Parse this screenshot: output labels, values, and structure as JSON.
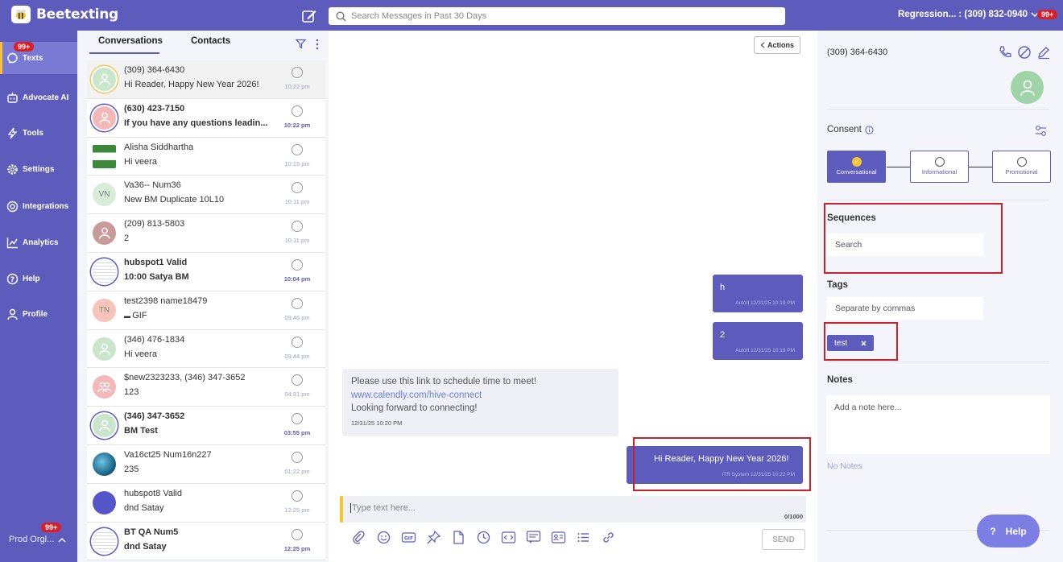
{
  "app": {
    "name": "Beetexting"
  },
  "header": {
    "search_placeholder": "Search Messages in Past 30 Days",
    "account_label": "Regression... : (309) 832-0940",
    "account_badge": "99+"
  },
  "nav": {
    "items": [
      {
        "label": "Texts",
        "icon": "chat-bubble-icon",
        "active": true,
        "badge": "99+"
      },
      {
        "label": "Advocate AI",
        "icon": "robot-icon"
      },
      {
        "label": "Tools",
        "icon": "lightning-icon"
      },
      {
        "label": "Settings",
        "icon": "gear-icon"
      },
      {
        "label": "Integrations",
        "icon": "integrations-icon"
      },
      {
        "label": "Analytics",
        "icon": "chart-icon"
      },
      {
        "label": "Help",
        "icon": "help-icon"
      },
      {
        "label": "Profile",
        "icon": "person-icon"
      }
    ],
    "org_label": "Prod Orgl...",
    "org_badge": "99+"
  },
  "conversations": {
    "tabs": [
      "Conversations",
      "Contacts"
    ],
    "items": [
      {
        "name": "(309) 364-6430",
        "message": "Hi Reader, Happy New Year 2026!",
        "time": "10:22 pm",
        "bold": false,
        "avatar_type": "person",
        "avatar_bg": "#c9e6cd",
        "avatar_ring": "#f0c75e"
      },
      {
        "name": "(630) 423-7150",
        "message": "If you have any questions leadin...",
        "time": "10:22 pm",
        "bold": true,
        "avatar_type": "person",
        "avatar_bg": "#f4b8b8",
        "avatar_ring": "#5d5cbd"
      },
      {
        "name": "Alisha Siddhartha",
        "message": "Hi veera",
        "time": "10:15 pm",
        "bold": false,
        "avatar_type": "photo-flag",
        "avatar_bg": "#3a8a3a",
        "avatar_ring": ""
      },
      {
        "name": "Va36-- Num36",
        "message": "New BM Duplicate 10L10",
        "time": "10:11 pm",
        "bold": false,
        "avatar_type": "initials",
        "initials": "VN",
        "avatar_bg": "#d7ecd9",
        "avatar_ring": ""
      },
      {
        "name": "(209) 813-5803",
        "message": "2",
        "time": "10:11 pm",
        "bold": false,
        "avatar_type": "person",
        "avatar_bg": "#c89b9b",
        "avatar_ring": ""
      },
      {
        "name": "hubspot1 Valid",
        "message": "10:00 Satya BM",
        "time": "10:04 pm",
        "bold": true,
        "avatar_type": "photo-doc",
        "avatar_bg": "#ffffff",
        "avatar_ring": "#5d5cbd"
      },
      {
        "name": "test2398 name18479",
        "message": "GIF",
        "time": "09:46 pm",
        "bold": false,
        "avatar_type": "initials",
        "initials": "TN",
        "avatar_bg": "#f7c4b9",
        "avatar_ring": ""
      },
      {
        "name": "(346) 476-1834",
        "message": "Hi veera",
        "time": "09:44 pm",
        "bold": false,
        "avatar_type": "person",
        "avatar_bg": "#c9e6cd",
        "avatar_ring": ""
      },
      {
        "name": "$new2323233, (346) 347-3652",
        "message": "123",
        "time": "04:31 pm",
        "bold": false,
        "avatar_type": "group",
        "avatar_bg": "#f4b8b8",
        "avatar_ring": ""
      },
      {
        "name": "(346) 347-3652",
        "message": "BM Test",
        "time": "03:55 pm",
        "bold": true,
        "avatar_type": "person",
        "avatar_bg": "#c9e6cd",
        "avatar_ring": "#5d5cbd"
      },
      {
        "name": "Va16ct25 Num16n227",
        "message": "235",
        "time": "01:22 pm",
        "bold": false,
        "avatar_type": "photo-earth",
        "avatar_bg": "#1d6a8c",
        "avatar_ring": ""
      },
      {
        "name": "hubspot8 Valid",
        "message": "dnd Satay",
        "time": "12:25 pm",
        "bold": false,
        "avatar_type": "solid",
        "avatar_bg": "#5456c9",
        "avatar_ring": ""
      },
      {
        "name": "BT QA Num5",
        "message": "dnd Satay",
        "time": "12:25 pm",
        "bold": true,
        "avatar_type": "photo-doc",
        "avatar_bg": "#ffffff",
        "avatar_ring": "#5d5cbd"
      }
    ]
  },
  "chat": {
    "actions_label": "Actions",
    "messages_out": [
      {
        "text": "h",
        "meta": "AutoII 12/31/25 10:19 PM"
      },
      {
        "text": "2",
        "meta": "AutoII 12/31/25 10:19 PM"
      },
      {
        "text": "Hi Reader, Happy New Year 2026!",
        "meta": "ITR System 12/31/25 10:22 PM"
      }
    ],
    "message_in": {
      "text_before": "Please use this link to schedule time to meet! ",
      "link": "www.calendly.com/hive-connect",
      "text_after": "Looking forward to connecting!",
      "meta": "12/31/25 10:20 PM"
    },
    "input_placeholder": "Type text here...",
    "char_count": "0/1000",
    "send_label": "SEND",
    "toolbar_icons": [
      "attachment-icon",
      "emoji-icon",
      "gif-icon",
      "pin-icon",
      "document-icon",
      "clock-icon",
      "code-icon",
      "template-icon",
      "contact-card-icon",
      "list-icon",
      "link-icon"
    ]
  },
  "contact_panel": {
    "phone": "(309) 364-6430",
    "consent_title": "Consent",
    "consent_options": [
      {
        "label": "Conversational",
        "active": true
      },
      {
        "label": "Informational",
        "active": false
      },
      {
        "label": "Promotional",
        "active": false
      }
    ],
    "sequences_title": "Sequences",
    "sequences_placeholder": "Search",
    "tags_title": "Tags",
    "tags_placeholder": "Separate by commas",
    "tags": [
      "test"
    ],
    "notes_title": "Notes",
    "notes_placeholder": "Add a note here...",
    "no_notes": "No Notes",
    "help_label": "Help"
  },
  "colors": {
    "brand": "#5d5cbd",
    "accent": "#f5c431",
    "badge": "#d9202a",
    "highlight_box": "#c9222a"
  }
}
